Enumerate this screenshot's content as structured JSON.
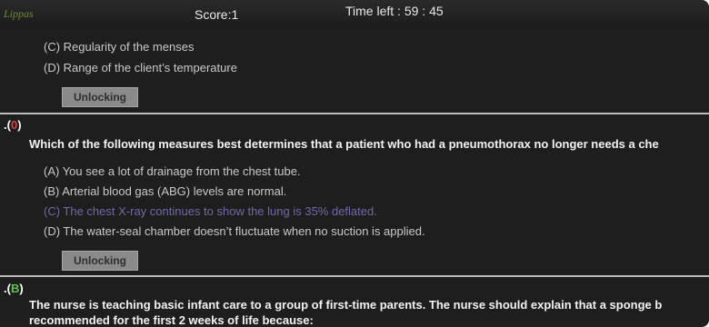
{
  "header": {
    "logo_text": "Lippas",
    "score": "Score:1",
    "timer": "Time left : 59 : 45"
  },
  "q_prev": {
    "options": [
      {
        "label": "(C) Regularity of the menses"
      },
      {
        "label": "(D) Range of the client’s temperature"
      }
    ],
    "unlock_label": "Unlocking"
  },
  "q_current": {
    "number_prefix": ".(",
    "answer_letter": "0",
    "number_suffix": ")",
    "text": "Which of the following measures best determines that a patient who had a pneumothorax no longer needs a che",
    "options": [
      {
        "label": "(A) You see a lot of drainage from the chest tube."
      },
      {
        "label": "(B) Arterial blood gas (ABG) levels are normal."
      },
      {
        "label": "(C) The chest X-ray continues to show the lung is 35% deflated."
      },
      {
        "label": "(D) The water-seal chamber doesn’t fluctuate when no suction is applied."
      }
    ],
    "unlock_label": "Unlocking"
  },
  "q_next": {
    "number_prefix": ".(",
    "answer_letter": "B",
    "number_suffix": ")",
    "text_line1": "The nurse is teaching basic infant care to a group of first-time parents. The nurse should explain that a sponge b",
    "text_line2": "recommended for the first 2 weeks of life because:"
  },
  "colors": {
    "background": "#1e1e1e",
    "option_text": "#c9c9c9",
    "highlight_option": "#6e6aa8",
    "answer_red": "#e23b3b",
    "next_answer_green": "#59c64a",
    "separator": "#bdbdbd",
    "button_bg": "#8a8a8a"
  }
}
